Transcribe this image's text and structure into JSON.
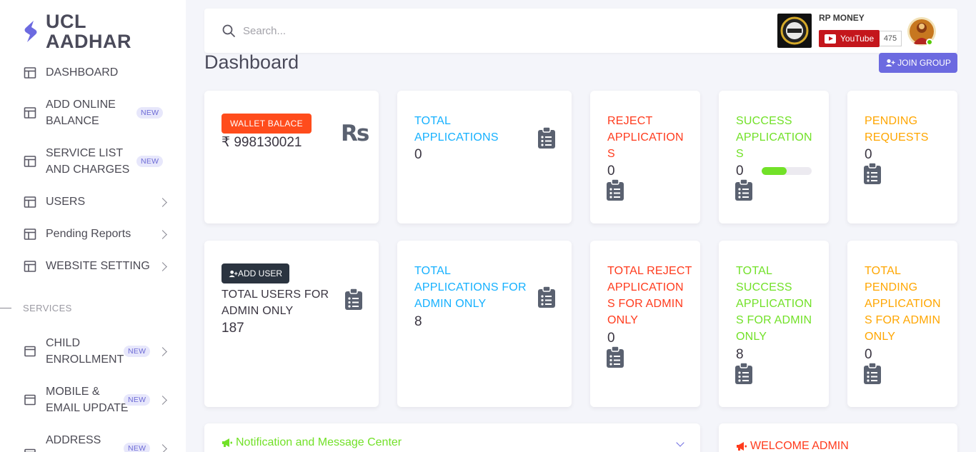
{
  "brand": {
    "line1": "UCL",
    "line2": "AADHAR"
  },
  "sidebar": {
    "items": [
      {
        "label_lines": [
          "DASHBOARD"
        ],
        "badge": "",
        "chevron": false
      },
      {
        "label_lines": [
          "ADD ONLINE",
          "BALANCE"
        ],
        "badge": "NEW",
        "chevron": false
      },
      {
        "label_lines": [
          "SERVICE LIST",
          "AND CHARGES"
        ],
        "badge": "NEW",
        "chevron": false
      },
      {
        "label_lines": [
          "USERS"
        ],
        "badge": "",
        "chevron": true
      },
      {
        "label_lines": [
          "Pending Reports"
        ],
        "badge": "",
        "chevron": true
      },
      {
        "label_lines": [
          "WEBSITE SETTING"
        ],
        "badge": "",
        "chevron": true
      }
    ],
    "section_title": "SERVICES",
    "service_items": [
      {
        "label_lines": [
          "CHILD",
          "ENROLLMENT"
        ],
        "badge": "NEW",
        "chevron": true
      },
      {
        "label_lines": [
          "MOBILE &",
          "EMAIL UPDATE"
        ],
        "badge": "NEW",
        "chevron": true
      },
      {
        "label_lines": [
          "ADDRESS"
        ],
        "badge": "NEW",
        "chevron": true
      }
    ]
  },
  "topbar": {
    "search_placeholder": "Search...",
    "channel_name": "RP MONEY",
    "youtube_label": "YouTube",
    "subscriber_count": "475"
  },
  "page": {
    "title": "Dashboard",
    "join_group_label": "JOIN GROUP"
  },
  "cards_row1": {
    "wallet": {
      "badge": "WALLET BALACE",
      "value": "₹ 998130021",
      "currency_mark": "Rs"
    },
    "total_applications": {
      "label_lines": [
        "TOTAL",
        "APPLICATIONS"
      ],
      "value": "0"
    },
    "reject_applications": {
      "label_lines": [
        "REJECT",
        "APPLICATION",
        "S"
      ],
      "value": "0"
    },
    "success_applications": {
      "label_lines": [
        "SUCCESS",
        "APPLICATION",
        "S"
      ],
      "value": "0",
      "progress": 0.5
    },
    "pending_requests": {
      "label_lines": [
        "PENDING",
        "REQUESTS"
      ],
      "value": "0"
    }
  },
  "cards_row2": {
    "users": {
      "button": "ADD USER",
      "label_lines": [
        "TOTAL USERS FOR",
        "ADMIN ONLY"
      ],
      "value": "187"
    },
    "total_applications_admin": {
      "label_lines": [
        "TOTAL",
        "APPLICATIONS FOR",
        "ADMIN ONLY"
      ],
      "value": "8"
    },
    "total_reject_admin": {
      "label_lines": [
        "TOTAL REJECT",
        "APPLICATION",
        "S FOR ADMIN",
        "ONLY"
      ],
      "value": "0"
    },
    "total_success_admin": {
      "label_lines": [
        "TOTAL",
        "SUCCESS",
        "APPLICATION",
        "S FOR ADMIN",
        "ONLY"
      ],
      "value": "8"
    },
    "total_pending_admin": {
      "label_lines": [
        "TOTAL",
        "PENDING",
        "APPLICATION",
        "S FOR ADMIN",
        "ONLY"
      ],
      "value": "0"
    }
  },
  "notifications": {
    "title": "Notification and Message Center"
  },
  "welcome": {
    "title": "WELCOME ADMIN"
  },
  "colors": {
    "accent": "#6c6ae0",
    "cyan": "#16b1ff",
    "red": "#ff3b1d",
    "green": "#72e128",
    "orange": "#ffa600",
    "wallet_badge": "#ff4c1c",
    "youtube": "#c4161c"
  },
  "icons": {
    "brand": "brand-logo-icon",
    "nav": "layout-icon",
    "services": "window-icon",
    "search": "search-icon",
    "clipboard": "clipboard-list-icon",
    "bullhorn": "bullhorn-icon",
    "join": "user-plus-icon"
  }
}
